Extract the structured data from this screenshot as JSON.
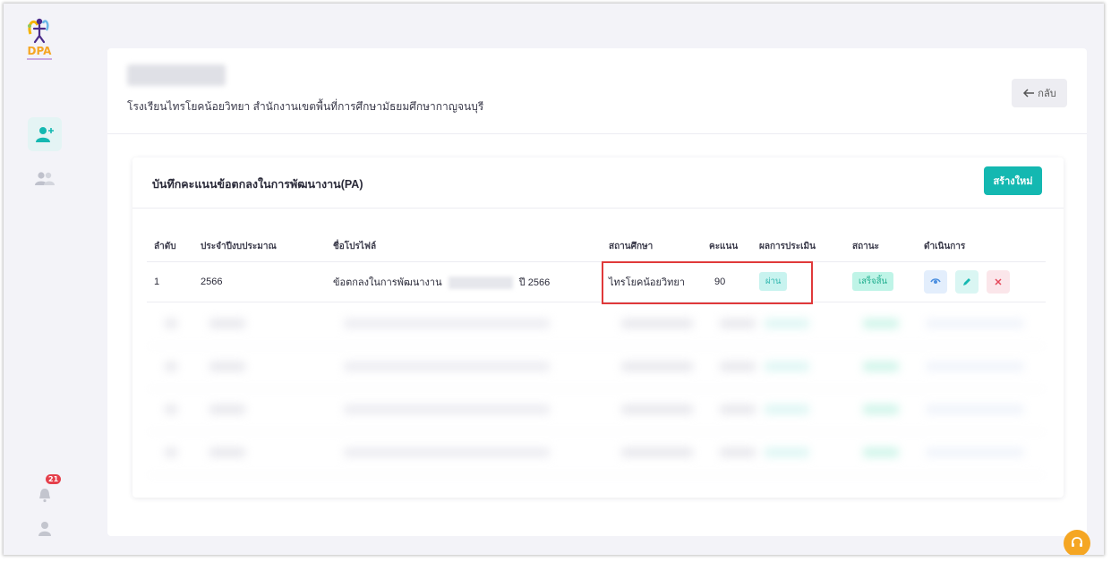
{
  "logo": {
    "text": "DPA"
  },
  "sidebar": {
    "add_user": "add-user-icon",
    "users": "users-icon",
    "notifications_count": "21",
    "profile": "profile-icon"
  },
  "header": {
    "school_line": "โรงเรียนไทรโยคน้อยวิทยา สำนักงานเขตพื้นที่การศึกษามัธยมศึกษากาญจนบุรี",
    "back_label": "กลับ"
  },
  "card": {
    "title": "บันทึกคะแนนข้อตกลงในการพัฒนางาน(PA)",
    "create_label": "สร้างใหม่"
  },
  "table": {
    "headers": [
      "ลำดับ",
      "ประจำปีงบประมาณ",
      "ชื่อโปรไฟล์",
      "สถานศึกษา",
      "คะแนน",
      "ผลการประเมิน",
      "สถานะ",
      "ดำเนินการ"
    ],
    "rows": [
      {
        "no": "1",
        "year": "2566",
        "profile_prefix": "ข้อตกลงในการพัฒนางาน",
        "profile_suffix": "ปี 2566",
        "school": "ไทรโยคน้อยวิทยา",
        "score": "90",
        "result": "ผ่าน",
        "status": "เสร็จสิ้น"
      }
    ]
  },
  "colors": {
    "accent": "#14b8b1",
    "highlight": "#e0393a",
    "support": "#f5a623"
  }
}
